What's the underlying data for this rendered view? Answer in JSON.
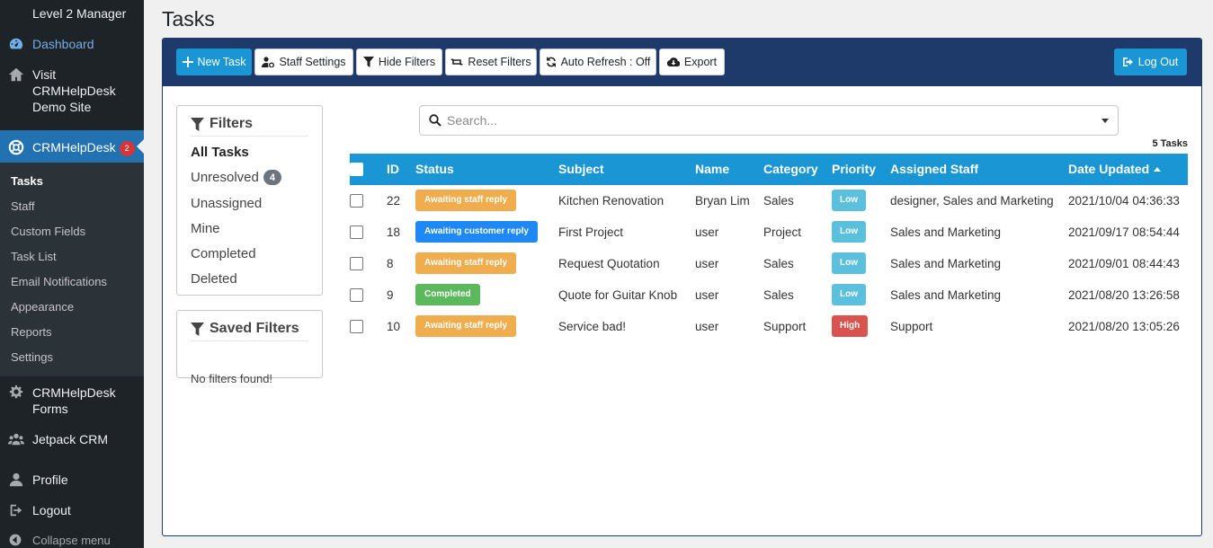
{
  "sidebar": {
    "user_role": "Level 2 Manager",
    "dashboard": "Dashboard",
    "visit": "Visit CRMHelpDesk Demo Site",
    "crm": "CRMHelpDesk",
    "crm_badge": "2",
    "submenu": [
      "Tasks",
      "Staff",
      "Custom Fields",
      "Task List",
      "Email Notifications",
      "Appearance",
      "Reports",
      "Settings"
    ],
    "forms": "CRMHelpDesk Forms",
    "jetpack": "Jetpack CRM",
    "profile": "Profile",
    "logout": "Logout",
    "collapse": "Collapse menu"
  },
  "page": {
    "title": "Tasks"
  },
  "toolbar": {
    "new_task": "New Task",
    "staff_settings": "Staff Settings",
    "hide_filters": "Hide Filters",
    "reset_filters": "Reset Filters",
    "auto_refresh": "Auto Refresh : Off",
    "export": "Export",
    "log_out": "Log Out"
  },
  "filters": {
    "title": "Filters",
    "items": [
      {
        "label": "All Tasks",
        "active": true
      },
      {
        "label": "Unresolved",
        "count": "4"
      },
      {
        "label": "Unassigned"
      },
      {
        "label": "Mine"
      },
      {
        "label": "Completed"
      },
      {
        "label": "Deleted"
      }
    ]
  },
  "saved_filters": {
    "title": "Saved Filters",
    "empty": "No filters found!"
  },
  "search": {
    "placeholder": "Search..."
  },
  "task_count": "5 Tasks",
  "table": {
    "headers": {
      "id": "ID",
      "status": "Status",
      "subject": "Subject",
      "name": "Name",
      "category": "Category",
      "priority": "Priority",
      "staff": "Assigned Staff",
      "date": "Date Updated"
    },
    "rows": [
      {
        "id": "22",
        "status": "Awaiting staff reply",
        "subject": "Kitchen Renovation",
        "name": "Bryan Lim",
        "category": "Sales",
        "priority": "Low",
        "staff": "designer, Sales and Marketing",
        "date": "2021/10/04 04:36:33"
      },
      {
        "id": "18",
        "status": "Awaiting customer reply",
        "subject": "First Project",
        "name": "user",
        "category": "Project",
        "priority": "Low",
        "staff": "Sales and Marketing",
        "date": "2021/09/17 08:54:44"
      },
      {
        "id": "8",
        "status": "Awaiting staff reply",
        "subject": "Request Quotation",
        "name": "user",
        "category": "Sales",
        "priority": "Low",
        "staff": "Sales and Marketing",
        "date": "2021/09/01 08:44:43"
      },
      {
        "id": "9",
        "status": "Completed",
        "subject": "Quote for Guitar Knob",
        "name": "user",
        "category": "Sales",
        "priority": "Low",
        "staff": "Sales and Marketing",
        "date": "2021/08/20 13:26:58"
      },
      {
        "id": "10",
        "status": "Awaiting staff reply",
        "subject": "Service bad!",
        "name": "user",
        "category": "Support",
        "priority": "High",
        "staff": "Support",
        "date": "2021/08/20 13:05:26"
      }
    ]
  },
  "colors": {
    "navy": "#1e3a6a",
    "blue": "#1a96d4",
    "status_staff": "#f0ad4e",
    "status_customer": "#1e88f5",
    "status_completed": "#5cb85c",
    "priority_low": "#5bc0de",
    "priority_high": "#d9534f"
  }
}
